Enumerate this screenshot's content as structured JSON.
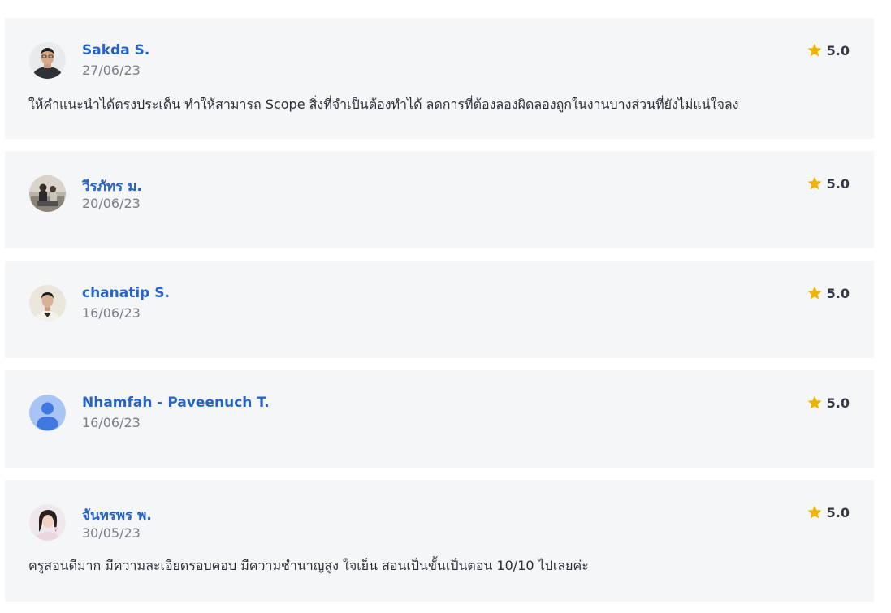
{
  "reviews": [
    {
      "name": "Sakda S.",
      "date": "27/06/23",
      "rating": "5.0",
      "comment": "ให้คำแนะนำได้ตรงประเด็น ทำให้สามารถ Scope สิ่งที่จำเป็นต้องทำได้ ลดการที่ต้องลองผิดลองถูกในงานบางส่วนที่ยังไม่แน่ใจลง",
      "avatar": "profile-photo"
    },
    {
      "name": "วีรภัทร ม.",
      "date": "20/06/23",
      "rating": "5.0",
      "comment": "",
      "avatar": "profile-photo"
    },
    {
      "name": "chanatip S.",
      "date": "16/06/23",
      "rating": "5.0",
      "comment": "",
      "avatar": "profile-photo"
    },
    {
      "name": "Nhamfah - Paveenuch T.",
      "date": "16/06/23",
      "rating": "5.0",
      "comment": "",
      "avatar": "default-user-icon"
    },
    {
      "name": "จันทรพร พ.",
      "date": "30/05/23",
      "rating": "5.0",
      "comment": "ครูสอนดีมาก มีความละเอียดรอบคอบ มีความชำนาญสูง ใจเย็น สอนเป็นขั้นเป็นตอน 10/10 ไปเลยค่ะ",
      "avatar": "profile-photo"
    }
  ],
  "colors": {
    "name": "#2563c9",
    "date": "#7a7f87",
    "card_bg": "#f5f6f8",
    "star": "#f0b400"
  }
}
